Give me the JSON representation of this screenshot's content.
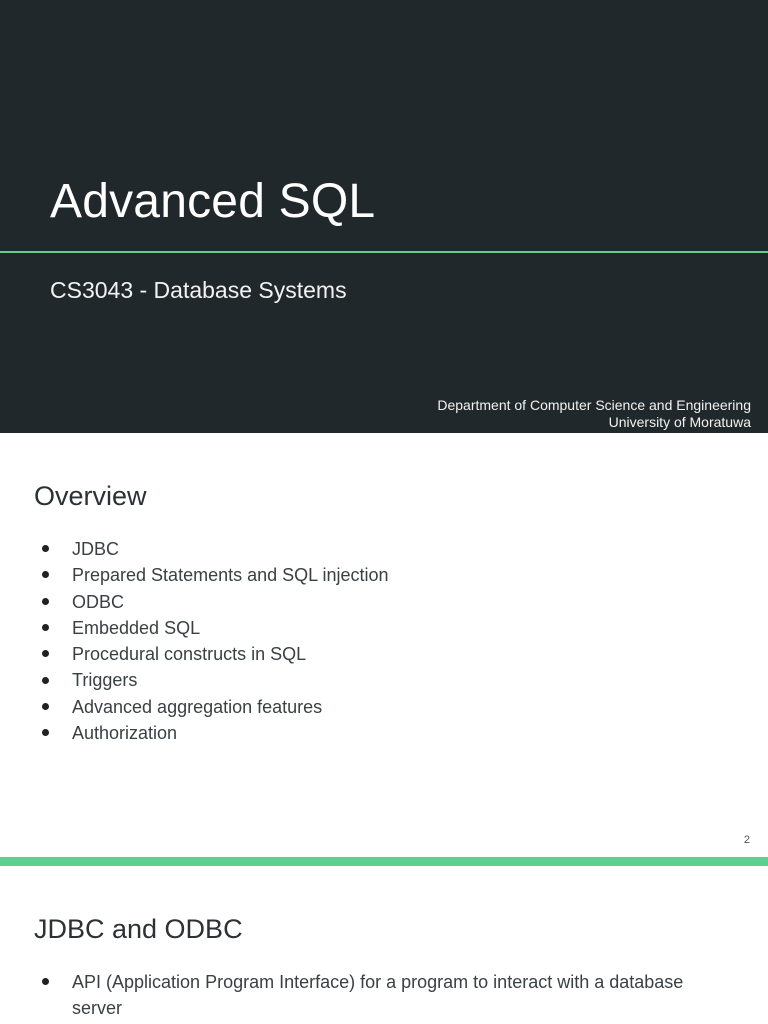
{
  "title_slide": {
    "title": "Advanced SQL",
    "subtitle": "CS3043 - Database Systems",
    "department": "Department of Computer Science and Engineering",
    "university": "University of Moratuwa"
  },
  "overview_slide": {
    "heading": "Overview",
    "items": [
      "JDBC",
      "Prepared Statements and SQL injection",
      "ODBC",
      "Embedded SQL",
      "Procedural constructs in SQL",
      "Triggers",
      "Advanced aggregation features",
      "Authorization"
    ],
    "page_number": "2"
  },
  "jdbc_slide": {
    "heading": "JDBC and ODBC",
    "items": [
      "API (Application Program Interface) for a program to interact with a database server"
    ]
  },
  "colors": {
    "title_background": "#21282b",
    "accent_green": "#5ecf8e"
  }
}
